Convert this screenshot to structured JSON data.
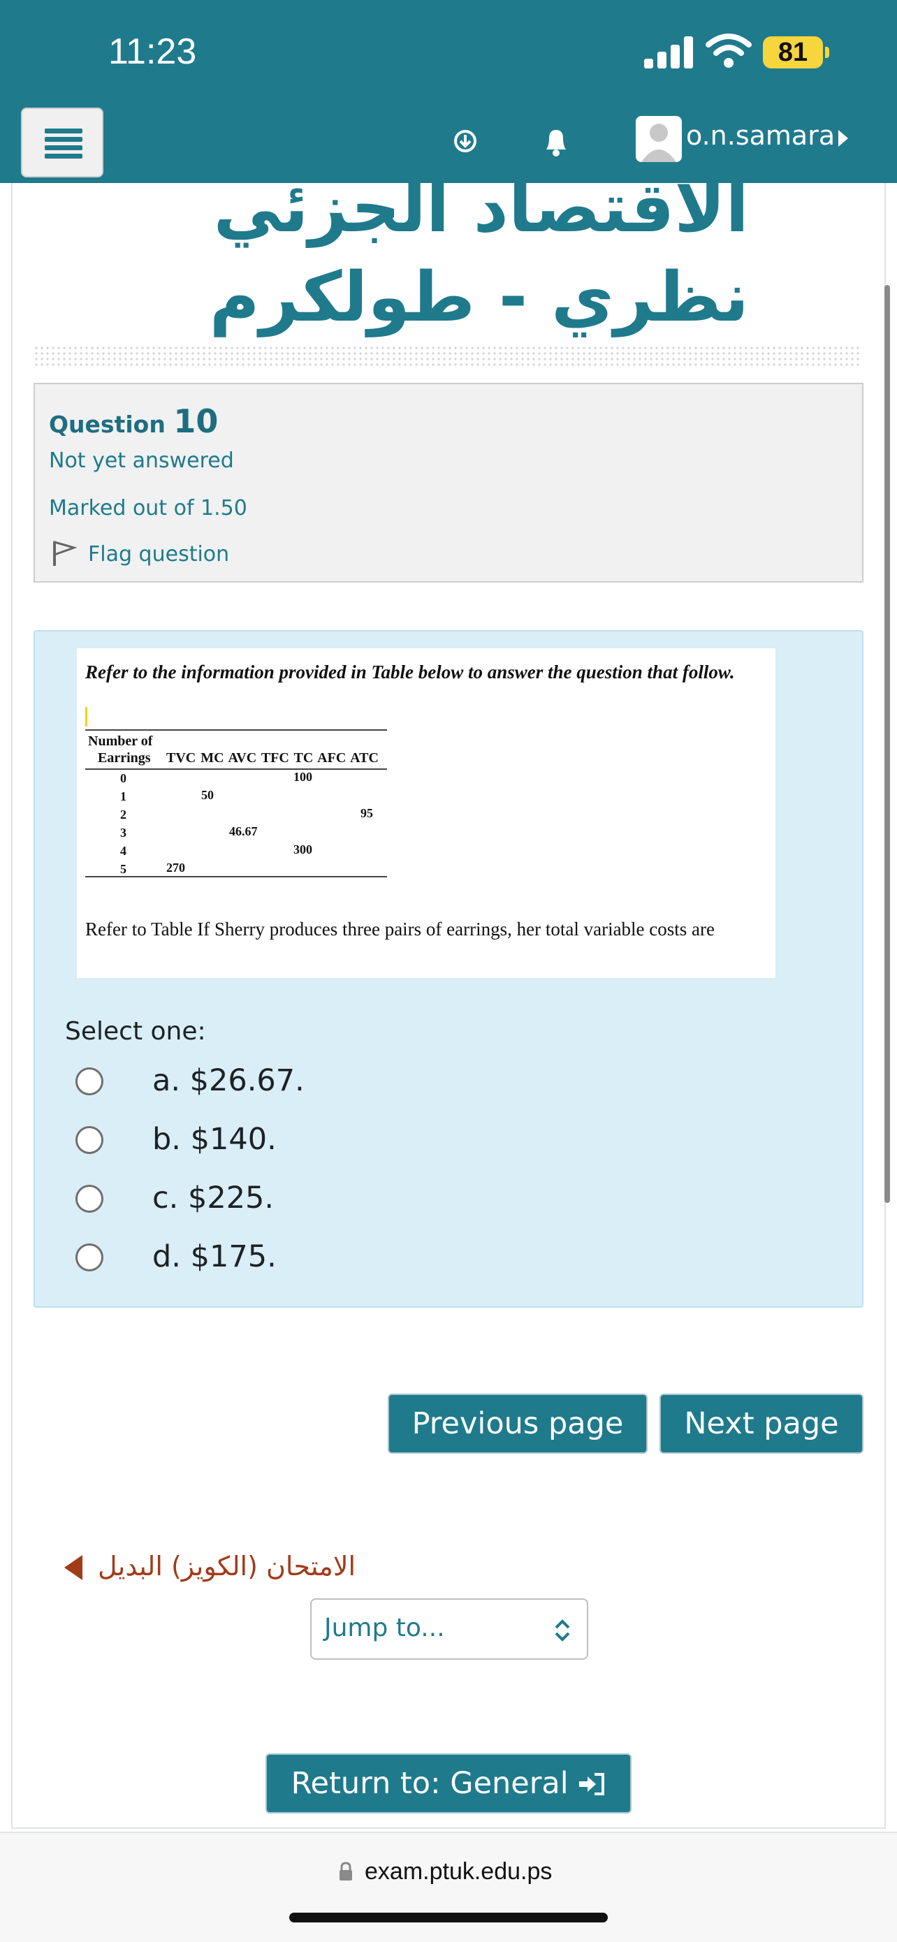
{
  "status_bar": {
    "time": "11:23",
    "battery": "81"
  },
  "nav": {
    "user_name": "o.n.samara",
    "icons": [
      "menu-icon",
      "download-icon",
      "bell-icon",
      "user-avatar-icon"
    ]
  },
  "page": {
    "title": "الاقتصاد الجزئي نظري - طولكرم"
  },
  "question_info": {
    "label": "Question",
    "number": "10",
    "status": "Not yet answered",
    "marks": "Marked out of 1.50",
    "flag": "Flag question"
  },
  "question_image": {
    "intro": "Refer to the information provided in Table below to answer the question that follow.",
    "header_line1": "Number of",
    "header_line2": "Earrings",
    "columns": "TVC MC AVC TFC TC  AFC ATC",
    "rows": [
      "0",
      "1",
      "2",
      "3",
      "4",
      "5"
    ],
    "values": {
      "tc0": "100",
      "mc1": "50",
      "afc2": "95",
      "avc3": "46.67",
      "tc4": "300",
      "tvc5": "270"
    },
    "question": "Refer to Table If Sherry produces three pairs of earrings, her total variable costs are"
  },
  "answers": {
    "prompt": "Select one:",
    "options": [
      "a. $26.67.",
      "b. $140.",
      "c. $225.",
      "d. $175."
    ]
  },
  "navigation": {
    "previous": "Previous page",
    "next": "Next page",
    "back_link": "الامتحان (الكويز) البديل",
    "jump_placeholder": "Jump to...",
    "return": "Return to: General"
  },
  "browser": {
    "url": "exam.ptuk.edu.ps"
  },
  "colors": {
    "primary": "#1f7a8c",
    "question_bg": "#d9eef6",
    "link_brown": "#a13b1a"
  }
}
